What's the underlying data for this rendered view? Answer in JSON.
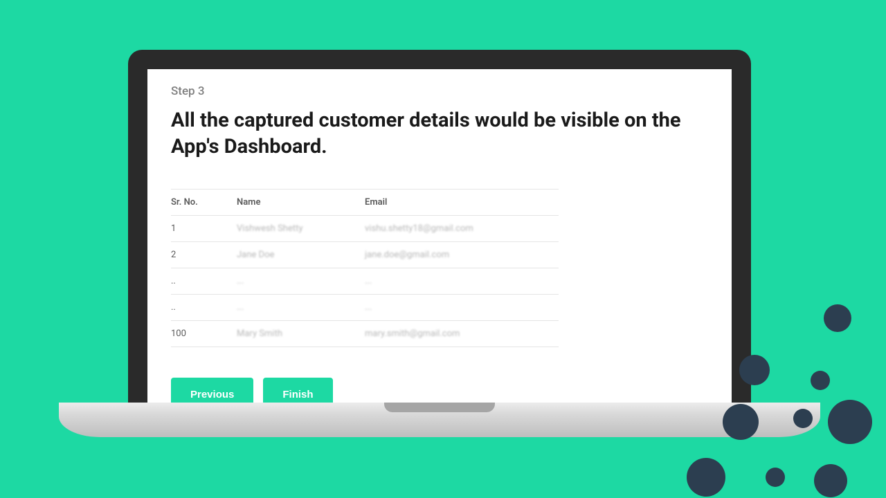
{
  "step_label": "Step 3",
  "heading": "All the captured customer details would be visible on the App's Dashboard.",
  "table": {
    "headers": {
      "sr": "Sr. No.",
      "name": "Name",
      "email": "Email"
    },
    "rows": [
      {
        "sr": "1",
        "name": "Vishwesh Shetty",
        "email": "vishu.shetty18@gmail.com"
      },
      {
        "sr": "2",
        "name": "Jane Doe",
        "email": "jane.doe@gmail.com"
      },
      {
        "sr": "..",
        "name": "...",
        "email": "..."
      },
      {
        "sr": "..",
        "name": "...",
        "email": "..."
      },
      {
        "sr": "100",
        "name": "Mary Smith",
        "email": "mary.smith@gmail.com"
      }
    ]
  },
  "buttons": {
    "previous": "Previous",
    "finish": "Finish"
  }
}
